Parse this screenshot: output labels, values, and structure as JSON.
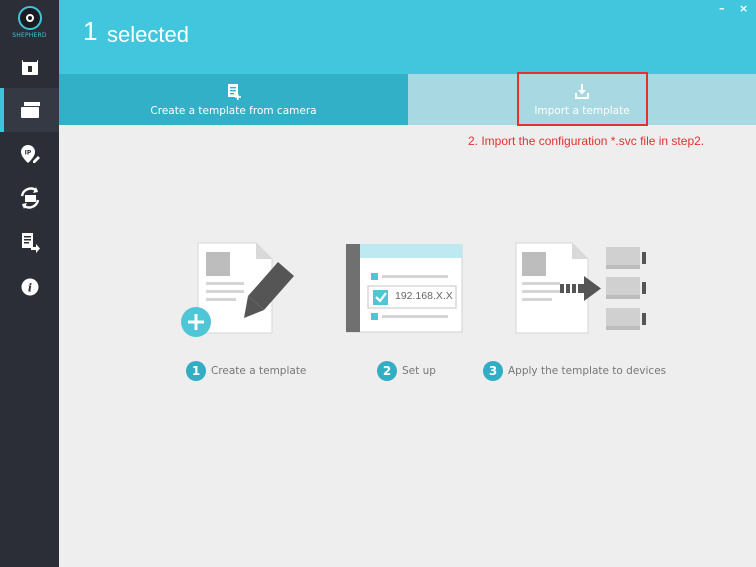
{
  "app": {
    "logo_text": "SHEPHERD"
  },
  "header": {
    "count": "1",
    "label": "selected",
    "minimize": "–",
    "close": "×"
  },
  "tabs": {
    "create": "Create a template from camera",
    "import": "Import a template"
  },
  "annotation": "2. Import the configuration *.svc file in step2.",
  "steps": [
    {
      "number": "1",
      "label": "Create a template"
    },
    {
      "number": "2",
      "label": "Set up"
    },
    {
      "number": "3",
      "label": "Apply the template to devices"
    }
  ],
  "setup_field": "192.168.X.X",
  "colors": {
    "accent": "#42c6dd",
    "sidebar": "#2b2e36",
    "annotation": "#e0332f"
  }
}
